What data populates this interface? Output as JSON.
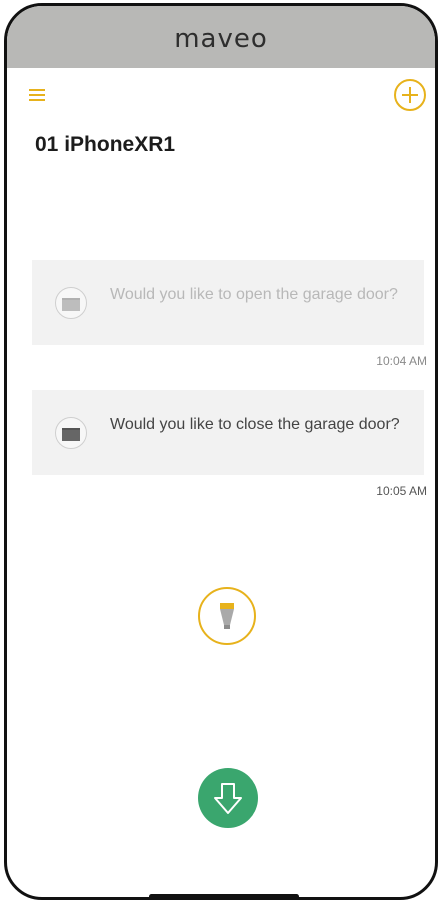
{
  "header": {
    "logo_text": "maveo"
  },
  "page": {
    "title": "01 iPhoneXR1"
  },
  "messages": [
    {
      "text": "Would you like to open the garage door?",
      "time": "10:04 AM"
    },
    {
      "text": "Would you like to close the garage door?",
      "time": "10:05 AM"
    }
  ],
  "colors": {
    "accent": "#e7b21c",
    "header_bg": "#b8b8b6",
    "green": "#3aa66e",
    "bubble_bg": "#f2f2f2"
  },
  "icons": {
    "menu": "hamburger-icon",
    "add": "plus-circle-icon",
    "garage": "garage-door-icon",
    "bulb": "lightbulb-icon",
    "down": "arrow-down-icon"
  }
}
